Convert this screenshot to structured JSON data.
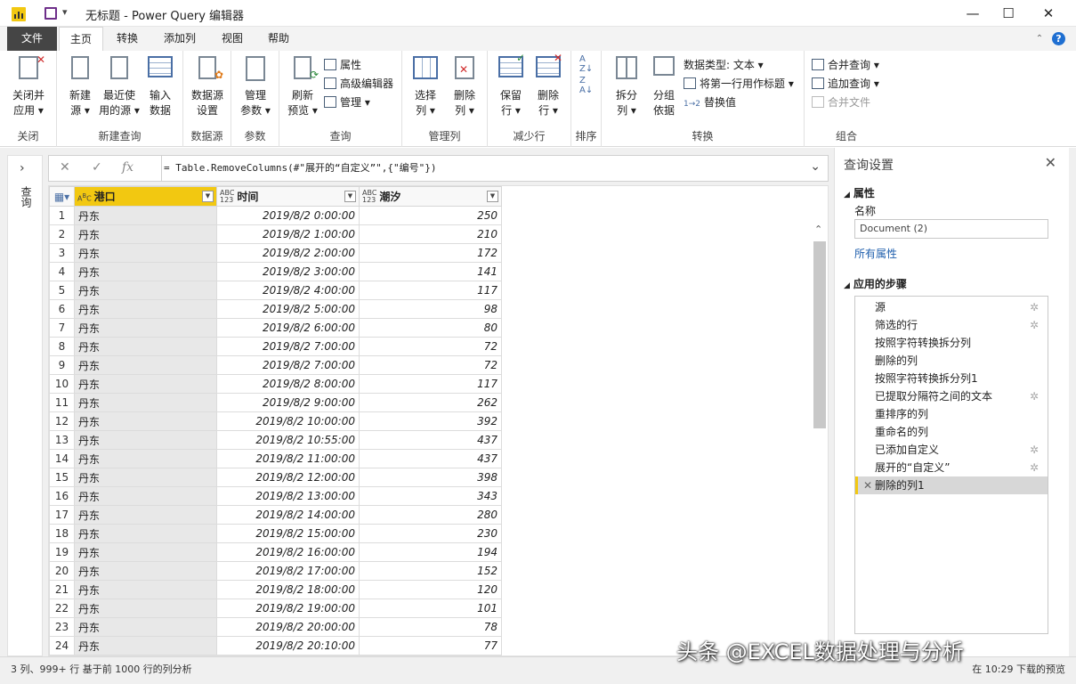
{
  "window": {
    "title": "无标题 - Power Query 编辑器",
    "minimize": "—",
    "maximize": "☐",
    "close": "✕"
  },
  "tabs": [
    "文件",
    "主页",
    "转换",
    "添加列",
    "视图",
    "帮助"
  ],
  "ribbon": {
    "close_group": {
      "label": "关闭",
      "btn": "关闭并\n应用 ▾"
    },
    "new_query_group": {
      "label": "新建查询",
      "new_source": "新建\n源 ▾",
      "recent": "最近使\n用的源 ▾",
      "enter": "输入\n数据"
    },
    "datasource_group": {
      "label": "数据源",
      "settings": "数据源\n设置"
    },
    "params_group": {
      "label": "参数",
      "manage": "管理\n参数 ▾"
    },
    "query_group": {
      "label": "查询",
      "refresh": "刷新\n预览 ▾",
      "props": "属性",
      "adv_editor": "高级编辑器",
      "manage": "管理 ▾"
    },
    "manage_cols_group": {
      "label": "管理列",
      "choose": "选择\n列 ▾",
      "remove": "删除\n列 ▾"
    },
    "reduce_rows_group": {
      "label": "减少行",
      "keep": "保留\n行 ▾",
      "remove": "删除\n行 ▾"
    },
    "sort_group": {
      "label": "排序"
    },
    "transform_group": {
      "label": "转换",
      "split": "拆分\n列 ▾",
      "groupby": "分组\n依据",
      "datatype": "数据类型: 文本 ▾",
      "first_row": "将第一行用作标题 ▾",
      "replace": "替换值"
    },
    "combine_group": {
      "label": "组合",
      "merge": "合并查询 ▾",
      "append": "追加查询 ▾",
      "combine_files": "合并文件"
    }
  },
  "left_pane": {
    "label": "查询"
  },
  "formula": "= Table.RemoveColumns(#\"展开的“自定义”\",{\"编号\"})",
  "columns": [
    {
      "type": "ABC",
      "name": "港口"
    },
    {
      "type": "ABC\n123",
      "name": "时间"
    },
    {
      "type": "ABC\n123",
      "name": "潮汐"
    }
  ],
  "rows": [
    [
      "丹东",
      "2019/8/2 0:00:00",
      "250"
    ],
    [
      "丹东",
      "2019/8/2 1:00:00",
      "210"
    ],
    [
      "丹东",
      "2019/8/2 2:00:00",
      "172"
    ],
    [
      "丹东",
      "2019/8/2 3:00:00",
      "141"
    ],
    [
      "丹东",
      "2019/8/2 4:00:00",
      "117"
    ],
    [
      "丹东",
      "2019/8/2 5:00:00",
      "98"
    ],
    [
      "丹东",
      "2019/8/2 6:00:00",
      "80"
    ],
    [
      "丹东",
      "2019/8/2 7:00:00",
      "72"
    ],
    [
      "丹东",
      "2019/8/2 7:00:00",
      "72"
    ],
    [
      "丹东",
      "2019/8/2 8:00:00",
      "117"
    ],
    [
      "丹东",
      "2019/8/2 9:00:00",
      "262"
    ],
    [
      "丹东",
      "2019/8/2 10:00:00",
      "392"
    ],
    [
      "丹东",
      "2019/8/2 10:55:00",
      "437"
    ],
    [
      "丹东",
      "2019/8/2 11:00:00",
      "437"
    ],
    [
      "丹东",
      "2019/8/2 12:00:00",
      "398"
    ],
    [
      "丹东",
      "2019/8/2 13:00:00",
      "343"
    ],
    [
      "丹东",
      "2019/8/2 14:00:00",
      "280"
    ],
    [
      "丹东",
      "2019/8/2 15:00:00",
      "230"
    ],
    [
      "丹东",
      "2019/8/2 16:00:00",
      "194"
    ],
    [
      "丹东",
      "2019/8/2 17:00:00",
      "152"
    ],
    [
      "丹东",
      "2019/8/2 18:00:00",
      "120"
    ],
    [
      "丹东",
      "2019/8/2 19:00:00",
      "101"
    ],
    [
      "丹东",
      "2019/8/2 20:00:00",
      "78"
    ],
    [
      "丹东",
      "2019/8/2 20:10:00",
      "77"
    ]
  ],
  "settings": {
    "title": "查询设置",
    "props_header": "属性",
    "name_label": "名称",
    "name_value": "Document (2)",
    "all_props": "所有属性",
    "steps_header": "应用的步骤",
    "steps": [
      {
        "label": "源",
        "gear": true
      },
      {
        "label": "筛选的行",
        "gear": true
      },
      {
        "label": "按照字符转换拆分列",
        "gear": false
      },
      {
        "label": "删除的列",
        "gear": false
      },
      {
        "label": "按照字符转换拆分列1",
        "gear": false
      },
      {
        "label": "已提取分隔符之间的文本",
        "gear": true
      },
      {
        "label": "重排序的列",
        "gear": false
      },
      {
        "label": "重命名的列",
        "gear": false
      },
      {
        "label": "已添加自定义",
        "gear": true
      },
      {
        "label": "展开的“自定义”",
        "gear": true
      },
      {
        "label": "删除的列1",
        "gear": false,
        "current": true
      }
    ]
  },
  "status": {
    "left": "3 列、999+ 行    基于前 1000 行的列分析",
    "right": "在 10:29 下载的预览"
  },
  "watermark": "头条 @EXCEL数据处理与分析",
  "colors": {
    "accent": "#f2c811",
    "file_tab": "#454545",
    "link": "#1f5fad"
  }
}
